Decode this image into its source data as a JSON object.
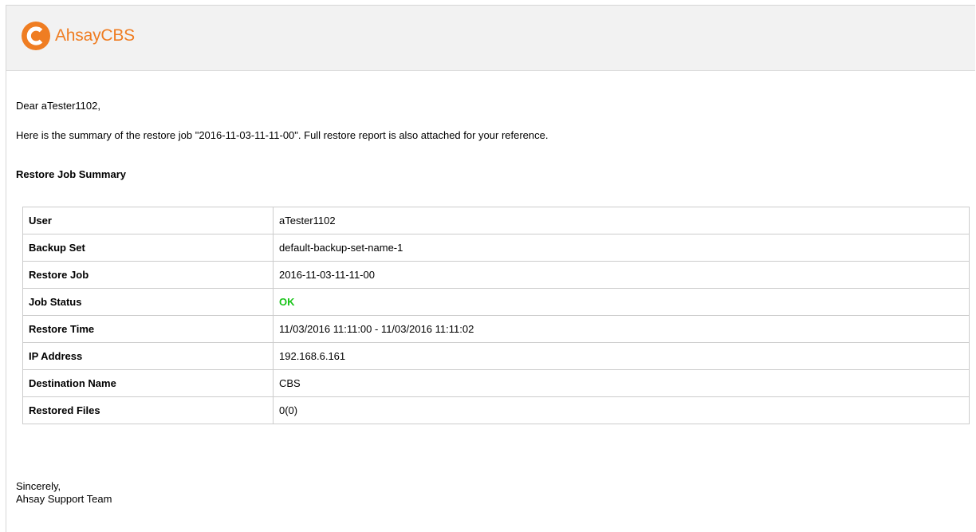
{
  "header": {
    "brand_name": "AhsayCBS",
    "brand_color": "#ef7d22",
    "logo_icon": "ahsay-logo-icon"
  },
  "email": {
    "greeting": "Dear aTester1102,",
    "intro": "Here is the summary of the restore job \"2016-11-03-11-11-00\". Full restore report is also attached for your reference.",
    "section_title": "Restore Job Summary",
    "summary": [
      {
        "label": "User",
        "value": "aTester1102"
      },
      {
        "label": "Backup Set",
        "value": "default-backup-set-name-1"
      },
      {
        "label": "Restore Job",
        "value": "2016-11-03-11-11-00"
      },
      {
        "label": "Job Status",
        "value": "OK",
        "status_color": "#19c419"
      },
      {
        "label": "Restore Time",
        "value": "11/03/2016 11:11:00 - 11/03/2016 11:11:02"
      },
      {
        "label": "IP Address",
        "value": "192.168.6.161"
      },
      {
        "label": "Destination Name",
        "value": "CBS"
      },
      {
        "label": "Restored Files",
        "value": "0(0)"
      }
    ],
    "signoff_line1": "Sincerely,",
    "signoff_line2": "Ahsay Support Team"
  }
}
